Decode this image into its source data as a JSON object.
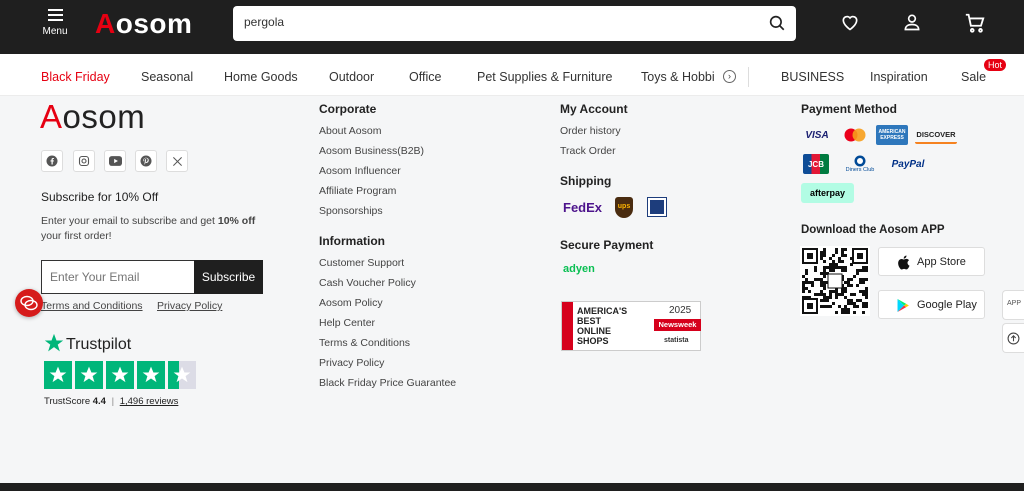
{
  "header": {
    "menu_label": "Menu",
    "logo": "Aosom",
    "search_value": "pergola"
  },
  "nav": {
    "items": [
      "Black Friday",
      "Seasonal",
      "Home Goods",
      "Outdoor",
      "Office",
      "Pet Supplies & Furniture",
      "Toys & Hobbi",
      "BUSINESS",
      "Inspiration",
      "Sale"
    ],
    "hot_badge": "Hot"
  },
  "footer": {
    "logo": "Aosom",
    "subscribe_title": "Subscribe for 10% Off",
    "subscribe_text_a": "Enter your email to subscribe and get ",
    "subscribe_text_bold": "10% off",
    "subscribe_text_b": "your first order!",
    "email_placeholder": "Enter Your Email",
    "subscribe_button": "Subscribe",
    "terms_link": "Terms and Conditions",
    "privacy_link": "Privacy Policy",
    "trustpilot": {
      "brand": "Trustpilot",
      "score_label": "TrustScore",
      "score": "4.4",
      "separator": "|",
      "reviews": "1,496 reviews"
    },
    "corporate": {
      "title": "Corporate",
      "links": [
        "About Aosom",
        "Aosom Business(B2B)",
        "Aosom Influencer",
        "Affiliate Program",
        "Sponsorships"
      ]
    },
    "information": {
      "title": "Information",
      "links": [
        "Customer Support",
        "Cash Voucher Policy",
        "Aosom Policy",
        "Help Center",
        "Terms & Conditions",
        "Privacy Policy",
        "Black Friday Price Guarantee"
      ]
    },
    "account": {
      "title": "My Account",
      "links": [
        "Order history",
        "Track Order"
      ]
    },
    "shipping": {
      "title": "Shipping",
      "carriers": [
        "FedEx",
        "ups"
      ]
    },
    "secure": {
      "title": "Secure Payment",
      "provider": "adyen"
    },
    "award": {
      "line1": "AMERICA'S",
      "line2": "BEST",
      "line3": "ONLINE",
      "line4": "SHOPS",
      "year": "2025",
      "brand": "Newsweek",
      "partner": "statista"
    },
    "payment": {
      "title": "Payment Method",
      "visa": "VISA",
      "amex": "AMERICAN EXPRESS",
      "discover": "DISCOVER",
      "jcb": "JCB",
      "diners": "Diners Club",
      "paypal": "PayPal",
      "afterpay": "afterpay"
    },
    "app": {
      "title": "Download the Aosom APP",
      "app_store": "App Store",
      "google_play": "Google Play"
    },
    "side": {
      "app_label": "APP"
    }
  },
  "colors": {
    "brand_red": "#e60012",
    "dark": "#1f1f1f",
    "trustpilot_green": "#00b67a"
  }
}
